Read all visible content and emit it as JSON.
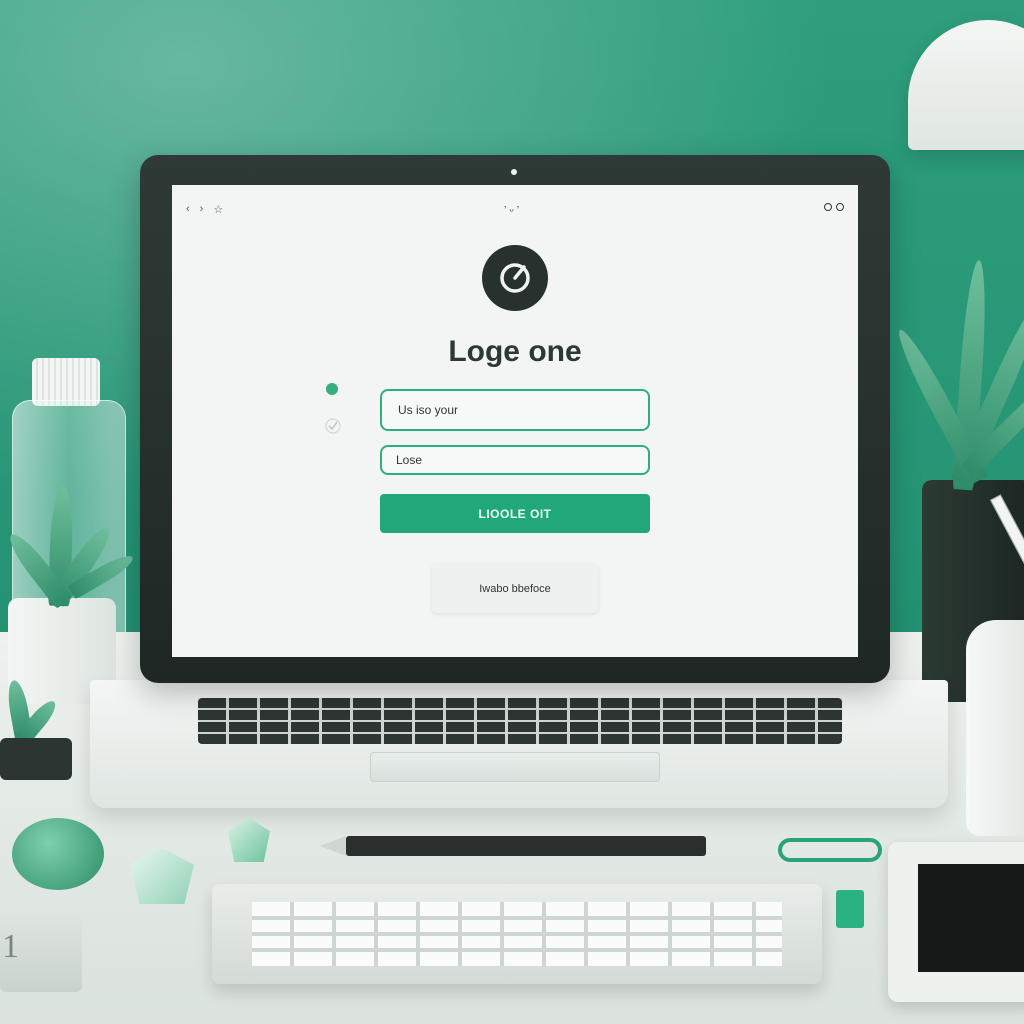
{
  "window": {
    "toolbar_left_icons": [
      "back-icon",
      "forward-icon",
      "star-icon"
    ],
    "toolbar_left_glyphs": [
      "‹",
      "›",
      "☆"
    ],
    "toolbar_center": "ʼ ᵕ ʼ",
    "toolbar_right_icons": [
      "circle-icon",
      "circle-icon"
    ]
  },
  "login": {
    "logo_icon": "power-icon",
    "title": "Loge one",
    "field1_text": "Us iso your",
    "field2_text": "Lose",
    "primary_button": "LIOOLE OIT",
    "secondary_button": "Iwabo bbefoce"
  },
  "desk": {
    "notebook_number": "1"
  },
  "colors": {
    "accent": "#21a77a",
    "field_border": "#2fae7c",
    "wall": "#249474",
    "screen_bg": "#f3f5f4"
  }
}
